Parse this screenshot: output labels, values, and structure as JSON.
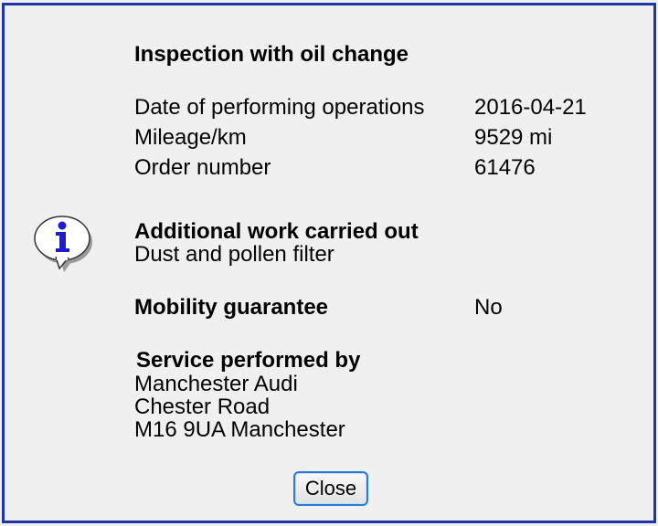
{
  "dialog": {
    "title": "Inspection with oil change",
    "details": [
      {
        "label": "Date of performing operations",
        "value": "2016-04-21"
      },
      {
        "label": "Mileage/km",
        "value": "9529 mi"
      },
      {
        "label": "Order number",
        "value": "61476"
      }
    ],
    "additional_work": {
      "heading": "Additional work carried out",
      "text": "Dust and pollen filter"
    },
    "mobility": {
      "heading": "Mobility guarantee",
      "value": "No"
    },
    "service": {
      "heading": "Service performed by",
      "lines": [
        "Manchester Audi",
        "Chester Road",
        "M16 9UA Manchester"
      ]
    },
    "close_label": "Close",
    "icon": "info-icon",
    "colors": {
      "border": "#1f36a8",
      "icon_blue": "#1c1cd6",
      "button_border": "#2a7bd8"
    }
  }
}
